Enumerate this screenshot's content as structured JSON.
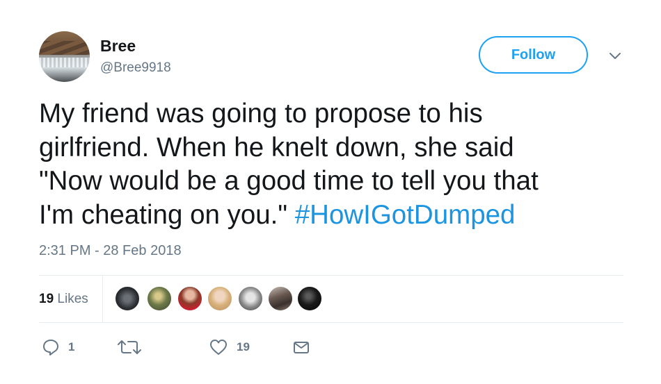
{
  "author": {
    "name": "Bree",
    "handle": "@Bree9918"
  },
  "follow_label": "Follow",
  "tweet": {
    "text_lines": [
      "My friend was going to propose to his",
      "girlfriend. When he knelt down, she said",
      "\"Now would be a good time to tell you that",
      "I'm cheating on you.\" "
    ],
    "hashtag": "#HowIGotDumped",
    "timestamp": "2:31 PM - 28 Feb 2018"
  },
  "likes": {
    "count": "19",
    "label": "Likes"
  },
  "actions": {
    "reply_count": "1",
    "like_count": "19"
  },
  "colors": {
    "accent": "#1da1f2",
    "hashtag": "#1b95e0",
    "muted": "#657786"
  },
  "icons": [
    "chevron-down-icon",
    "reply-icon",
    "retweet-icon",
    "heart-icon",
    "envelope-icon"
  ]
}
